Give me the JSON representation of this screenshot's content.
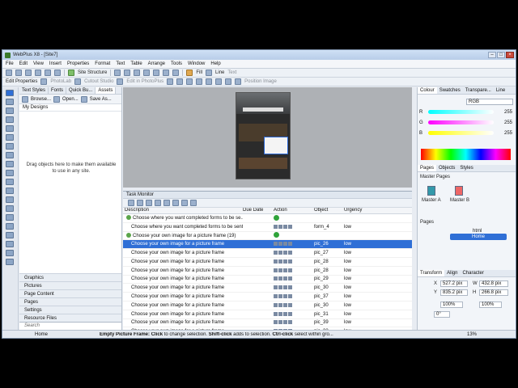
{
  "window": {
    "title": "WebPlus X8 - [Site7]"
  },
  "menu": [
    "File",
    "Edit",
    "View",
    "Insert",
    "Properties",
    "Format",
    "Text",
    "Table",
    "Arrange",
    "Tools",
    "Window",
    "Help"
  ],
  "toolbar1": {
    "site_structure": "Site Structure",
    "fill": "Fill",
    "line": "Line",
    "text": "Text"
  },
  "toolbar2": {
    "edit_properties": "Edit Properties",
    "photolab": "PhotoLab",
    "cutout": "Cutout Studio",
    "edit_photo": "Edit in PhotoPlus",
    "position_image": "Position Image"
  },
  "left_panel": {
    "tabs": [
      "Text Styles",
      "Fonts",
      "Quick Bu...",
      "Assets"
    ],
    "browse": "Browse...",
    "open": "Open...",
    "save_as": "Save As...",
    "my_designs": "My Designs",
    "hint": "Drag objects here to make them available to use in any site.",
    "categories": [
      "Graphics",
      "Pictures",
      "Page Content",
      "Pages",
      "Settings",
      "Resource Files"
    ],
    "search_placeholder": "Search"
  },
  "task_monitor": {
    "title": "Task Monitor",
    "columns": {
      "description": "Description",
      "due": "Due Date",
      "action": "Action",
      "object": "Object",
      "urgency": "Urgency"
    },
    "rows": [
      {
        "desc": "Choose where you want completed forms to be se...",
        "obj": "",
        "urg": "",
        "group": true
      },
      {
        "desc": "Choose where you want completed forms to be sent",
        "obj": "form_4",
        "urg": "low",
        "group": false
      },
      {
        "desc": "Choose your own image for a picture frame (19)",
        "obj": "",
        "urg": "",
        "group": true
      },
      {
        "desc": "Choose your own image for a picture frame",
        "obj": "pic_26",
        "urg": "low",
        "group": false,
        "selected": true
      },
      {
        "desc": "Choose your own image for a picture frame",
        "obj": "pic_27",
        "urg": "low",
        "group": false
      },
      {
        "desc": "Choose your own image for a picture frame",
        "obj": "pic_28",
        "urg": "low",
        "group": false
      },
      {
        "desc": "Choose your own image for a picture frame",
        "obj": "pic_28",
        "urg": "low",
        "group": false
      },
      {
        "desc": "Choose your own image for a picture frame",
        "obj": "pic_29",
        "urg": "low",
        "group": false
      },
      {
        "desc": "Choose your own image for a picture frame",
        "obj": "pic_30",
        "urg": "low",
        "group": false
      },
      {
        "desc": "Choose your own image for a picture frame",
        "obj": "pic_37",
        "urg": "low",
        "group": false
      },
      {
        "desc": "Choose your own image for a picture frame",
        "obj": "pic_30",
        "urg": "low",
        "group": false
      },
      {
        "desc": "Choose your own image for a picture frame",
        "obj": "pic_31",
        "urg": "low",
        "group": false
      },
      {
        "desc": "Choose your own image for a picture frame",
        "obj": "pic_39",
        "urg": "low",
        "group": false
      },
      {
        "desc": "Choose your own image for a picture frame",
        "obj": "pic_33",
        "urg": "low",
        "group": false
      }
    ]
  },
  "right_panel": {
    "color_tabs": [
      "Colour",
      "Swatches",
      "Transpare...",
      "Line"
    ],
    "color_mode": "RGB",
    "r": {
      "label": "R",
      "value": "255"
    },
    "g": {
      "label": "G",
      "value": "255"
    },
    "b": {
      "label": "B",
      "value": "255"
    },
    "pages_tabs": [
      "Pages",
      "Objects",
      "Styles"
    ],
    "master_pages": "Master Pages",
    "master_a": "Master A",
    "master_b": "Master B",
    "pages_label": "Pages",
    "html_label": "html",
    "home": "Home",
    "transform_tabs": [
      "Transform",
      "Align",
      "Character"
    ],
    "x": "527.2 pix",
    "y": "835.2 pix",
    "w": "432.8 pix",
    "h": "266.8 pix",
    "scale_x": "100%",
    "scale_y": "100%",
    "rotate": "0°"
  },
  "status": {
    "home": "Home",
    "text_prefix": "Empty Picture Frame: ",
    "click": "Click",
    "to_change": " to change selection. ",
    "shift_click": "Shift-click",
    "adds": " adds to selection. ",
    "ctrl_click": "Ctrl-click",
    "select_within": " select within gro...",
    "zoom": "13%"
  }
}
